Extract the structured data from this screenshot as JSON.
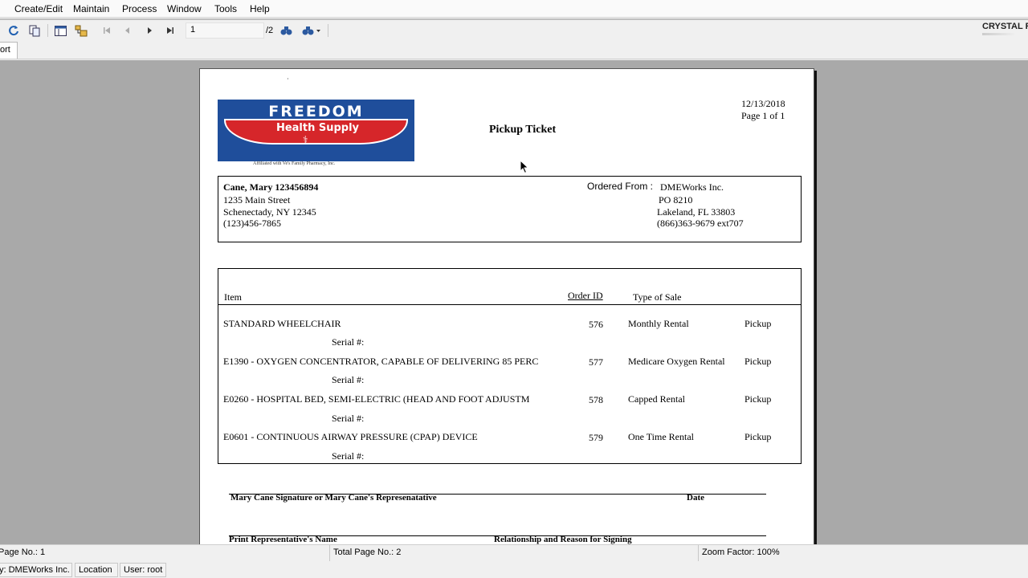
{
  "menu": [
    "Create/Edit",
    "Maintain",
    "Process",
    "Window",
    "Tools",
    "Help"
  ],
  "toolbar": {
    "page_current": "1",
    "page_total": "/2",
    "brand": "CRYSTAL R"
  },
  "tab": {
    "label": "ort"
  },
  "report": {
    "title": "Pickup Ticket",
    "date": "12/13/2018",
    "page_info": "Page 1 of 1",
    "logo": {
      "line1": "FREEDOM",
      "line2": "Health Supply",
      "caption": "Affiliated with Ve's Family Pharmacy, Inc."
    },
    "patient": {
      "name": "Cane, Mary 123456894",
      "address1": "1235 Main Street",
      "address2": "Schenectady, NY 12345",
      "phone": "(123)456-7865"
    },
    "vendor": {
      "label": "Ordered From :",
      "name": "DMEWorks Inc.",
      "address1": "PO 8210",
      "address2": "Lakeland, FL 33803",
      "phone": "(866)363-9679  ext707"
    },
    "columns": {
      "item": "Item",
      "order_id": "Order ID",
      "type_of_sale": "Type of Sale"
    },
    "serial_label": "Serial #:",
    "rows": [
      {
        "item": "STANDARD WHEELCHAIR",
        "order_id": "576",
        "sale_type": "Monthly Rental",
        "action": "Pickup"
      },
      {
        "item": "E1390 - OXYGEN CONCENTRATOR, CAPABLE OF DELIVERING 85 PERC",
        "order_id": "577",
        "sale_type": "Medicare Oxygen Rental",
        "action": "Pickup"
      },
      {
        "item": "E0260 - HOSPITAL BED, SEMI-ELECTRIC (HEAD AND FOOT ADJUSTM",
        "order_id": "578",
        "sale_type": "Capped Rental",
        "action": "Pickup"
      },
      {
        "item": "E0601 - CONTINUOUS AIRWAY PRESSURE (CPAP) DEVICE",
        "order_id": "579",
        "sale_type": "One Time Rental",
        "action": "Pickup"
      }
    ],
    "signature_label": "Mary Cane Signature  or Mary Cane's  Represenatative",
    "date_label": "Date",
    "print_rep_label": "Print Representative's Name",
    "relationship_label": "Relationship and Reason for Signing"
  },
  "status": {
    "page_no": "Page No.: 1",
    "total_pages": "Total Page No.: 2",
    "zoom": "Zoom Factor: 100%"
  },
  "statusbar2": {
    "company": "y: DMEWorks Inc.",
    "location": "Location",
    "user": "User: root"
  }
}
